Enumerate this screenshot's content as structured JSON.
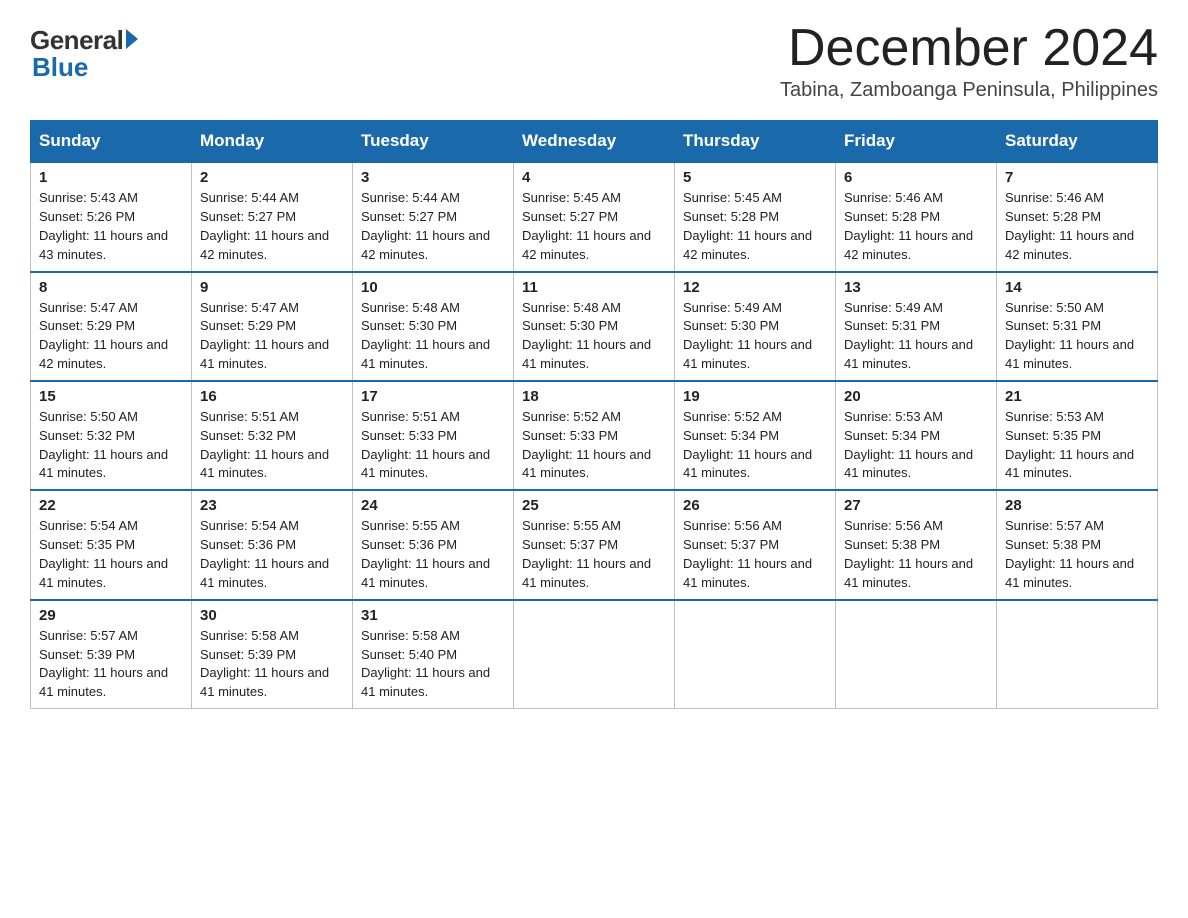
{
  "logo": {
    "general": "General",
    "blue": "Blue"
  },
  "header": {
    "month": "December 2024",
    "location": "Tabina, Zamboanga Peninsula, Philippines"
  },
  "weekdays": [
    "Sunday",
    "Monday",
    "Tuesday",
    "Wednesday",
    "Thursday",
    "Friday",
    "Saturday"
  ],
  "weeks": [
    [
      {
        "day": "1",
        "sunrise": "5:43 AM",
        "sunset": "5:26 PM",
        "daylight": "11 hours and 43 minutes."
      },
      {
        "day": "2",
        "sunrise": "5:44 AM",
        "sunset": "5:27 PM",
        "daylight": "11 hours and 42 minutes."
      },
      {
        "day": "3",
        "sunrise": "5:44 AM",
        "sunset": "5:27 PM",
        "daylight": "11 hours and 42 minutes."
      },
      {
        "day": "4",
        "sunrise": "5:45 AM",
        "sunset": "5:27 PM",
        "daylight": "11 hours and 42 minutes."
      },
      {
        "day": "5",
        "sunrise": "5:45 AM",
        "sunset": "5:28 PM",
        "daylight": "11 hours and 42 minutes."
      },
      {
        "day": "6",
        "sunrise": "5:46 AM",
        "sunset": "5:28 PM",
        "daylight": "11 hours and 42 minutes."
      },
      {
        "day": "7",
        "sunrise": "5:46 AM",
        "sunset": "5:28 PM",
        "daylight": "11 hours and 42 minutes."
      }
    ],
    [
      {
        "day": "8",
        "sunrise": "5:47 AM",
        "sunset": "5:29 PM",
        "daylight": "11 hours and 42 minutes."
      },
      {
        "day": "9",
        "sunrise": "5:47 AM",
        "sunset": "5:29 PM",
        "daylight": "11 hours and 41 minutes."
      },
      {
        "day": "10",
        "sunrise": "5:48 AM",
        "sunset": "5:30 PM",
        "daylight": "11 hours and 41 minutes."
      },
      {
        "day": "11",
        "sunrise": "5:48 AM",
        "sunset": "5:30 PM",
        "daylight": "11 hours and 41 minutes."
      },
      {
        "day": "12",
        "sunrise": "5:49 AM",
        "sunset": "5:30 PM",
        "daylight": "11 hours and 41 minutes."
      },
      {
        "day": "13",
        "sunrise": "5:49 AM",
        "sunset": "5:31 PM",
        "daylight": "11 hours and 41 minutes."
      },
      {
        "day": "14",
        "sunrise": "5:50 AM",
        "sunset": "5:31 PM",
        "daylight": "11 hours and 41 minutes."
      }
    ],
    [
      {
        "day": "15",
        "sunrise": "5:50 AM",
        "sunset": "5:32 PM",
        "daylight": "11 hours and 41 minutes."
      },
      {
        "day": "16",
        "sunrise": "5:51 AM",
        "sunset": "5:32 PM",
        "daylight": "11 hours and 41 minutes."
      },
      {
        "day": "17",
        "sunrise": "5:51 AM",
        "sunset": "5:33 PM",
        "daylight": "11 hours and 41 minutes."
      },
      {
        "day": "18",
        "sunrise": "5:52 AM",
        "sunset": "5:33 PM",
        "daylight": "11 hours and 41 minutes."
      },
      {
        "day": "19",
        "sunrise": "5:52 AM",
        "sunset": "5:34 PM",
        "daylight": "11 hours and 41 minutes."
      },
      {
        "day": "20",
        "sunrise": "5:53 AM",
        "sunset": "5:34 PM",
        "daylight": "11 hours and 41 minutes."
      },
      {
        "day": "21",
        "sunrise": "5:53 AM",
        "sunset": "5:35 PM",
        "daylight": "11 hours and 41 minutes."
      }
    ],
    [
      {
        "day": "22",
        "sunrise": "5:54 AM",
        "sunset": "5:35 PM",
        "daylight": "11 hours and 41 minutes."
      },
      {
        "day": "23",
        "sunrise": "5:54 AM",
        "sunset": "5:36 PM",
        "daylight": "11 hours and 41 minutes."
      },
      {
        "day": "24",
        "sunrise": "5:55 AM",
        "sunset": "5:36 PM",
        "daylight": "11 hours and 41 minutes."
      },
      {
        "day": "25",
        "sunrise": "5:55 AM",
        "sunset": "5:37 PM",
        "daylight": "11 hours and 41 minutes."
      },
      {
        "day": "26",
        "sunrise": "5:56 AM",
        "sunset": "5:37 PM",
        "daylight": "11 hours and 41 minutes."
      },
      {
        "day": "27",
        "sunrise": "5:56 AM",
        "sunset": "5:38 PM",
        "daylight": "11 hours and 41 minutes."
      },
      {
        "day": "28",
        "sunrise": "5:57 AM",
        "sunset": "5:38 PM",
        "daylight": "11 hours and 41 minutes."
      }
    ],
    [
      {
        "day": "29",
        "sunrise": "5:57 AM",
        "sunset": "5:39 PM",
        "daylight": "11 hours and 41 minutes."
      },
      {
        "day": "30",
        "sunrise": "5:58 AM",
        "sunset": "5:39 PM",
        "daylight": "11 hours and 41 minutes."
      },
      {
        "day": "31",
        "sunrise": "5:58 AM",
        "sunset": "5:40 PM",
        "daylight": "11 hours and 41 minutes."
      },
      null,
      null,
      null,
      null
    ]
  ]
}
